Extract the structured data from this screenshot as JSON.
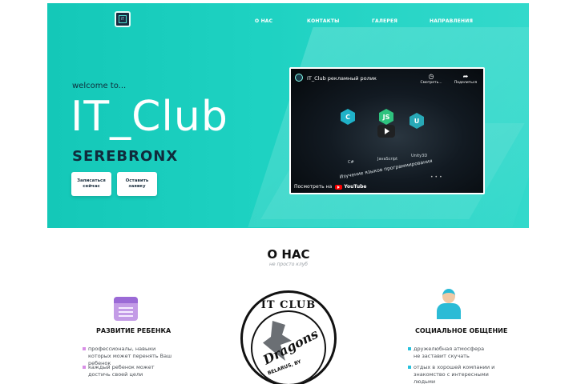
{
  "nav": {
    "logo_text": "IT",
    "items": [
      "О НАС",
      "КОНТАКТЫ",
      "ГАЛЕРЕЯ",
      "НАПРАВЛЕНИЯ"
    ]
  },
  "hero": {
    "welcome": "welcome to...",
    "title": "IT_Club",
    "subtitle": "SEREBRONX",
    "buttons": [
      "Записаться сейчас",
      "Оставить заявку"
    ]
  },
  "video": {
    "title": "IT_Club рекламный ролик",
    "watch_later": "Смотреть...",
    "share": "Поделиться",
    "langs": [
      "C#",
      "JavaScript",
      "Unity3D"
    ],
    "caption": "Изучение языков программирования",
    "watch_on": "Посмотреть на",
    "platform": "YouTube"
  },
  "about": {
    "title": "О НАС",
    "subtitle": "не просто клуб",
    "features": [
      {
        "title": "РАЗВИТИЕ РЕБЕНКА",
        "bullets": [
          "профессионалы, навыки которых может перенять Ваш ребенок",
          "каждый ребенок может достичь своей цели"
        ]
      },
      {
        "title": "СОЦИАЛЬНОЕ ОБЩЕНИЕ",
        "bullets": [
          "дружелюбная атмосфера не заставит скучать",
          "отдых в хорошей компании и знакомство с интересными людьми"
        ]
      }
    ],
    "emblem": {
      "top": "IT CLUB",
      "word": "Dragons",
      "bottom": "BELARUS, BY"
    }
  },
  "colors": {
    "hero_accent": "#1ed2c2",
    "purple_bullet": "#d88ee6",
    "cyan_bullet": "#27c1dd"
  }
}
